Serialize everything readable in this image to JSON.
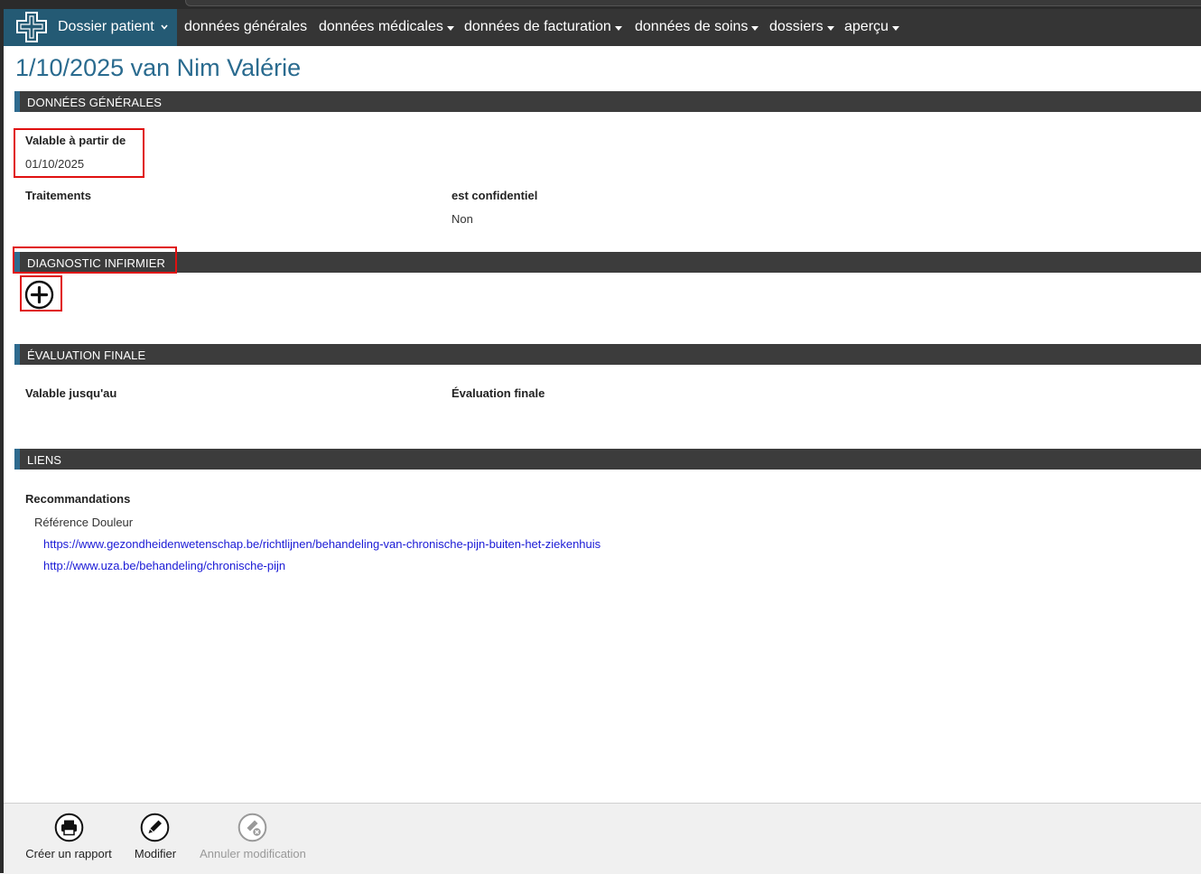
{
  "nav": {
    "brand_label": "Dossier patient",
    "items": [
      {
        "label": "données générales",
        "dropdown": false
      },
      {
        "label": "données médicales",
        "dropdown": true
      },
      {
        "label": "données de facturation",
        "dropdown": true
      },
      {
        "label": "données de soins",
        "dropdown": true
      },
      {
        "label": "dossiers",
        "dropdown": true
      },
      {
        "label": "aperçu",
        "dropdown": true
      }
    ]
  },
  "page": {
    "title": "1/10/2025 van Nim Valérie"
  },
  "sections": {
    "general": {
      "title": "DONNÉES GÉNÉRALES",
      "valid_from_label": "Valable à partir de",
      "valid_from_value": "01/10/2025",
      "treatments_label": "Traitements",
      "confidential_label": "est confidentiel",
      "confidential_value": "Non"
    },
    "diagnosis": {
      "title": "DIAGNOSTIC INFIRMIER",
      "add_icon": "plus-circle-icon"
    },
    "final_eval": {
      "title": "ÉVALUATION FINALE",
      "valid_until_label": "Valable jusqu'au",
      "final_eval_label": "Évaluation finale"
    },
    "links": {
      "title": "LIENS",
      "recommendations_label": "Recommandations",
      "reference_label": "Référence Douleur",
      "urls": [
        "https://www.gezondheidenwetenschap.be/richtlijnen/behandeling-van-chronische-pijn-buiten-het-ziekenhuis",
        "http://www.uza.be/behandeling/chronische-pijn"
      ]
    }
  },
  "toolbar": {
    "report_label": "Créer un rapport",
    "modify_label": "Modifier",
    "cancel_label": "Annuler modification"
  },
  "colors": {
    "nav_bg": "#353535",
    "brand_bg": "#245a74",
    "accent": "#2e6a8e",
    "title": "#2a6b8f",
    "link": "#1a1ad6",
    "highlight": "#e01010"
  }
}
